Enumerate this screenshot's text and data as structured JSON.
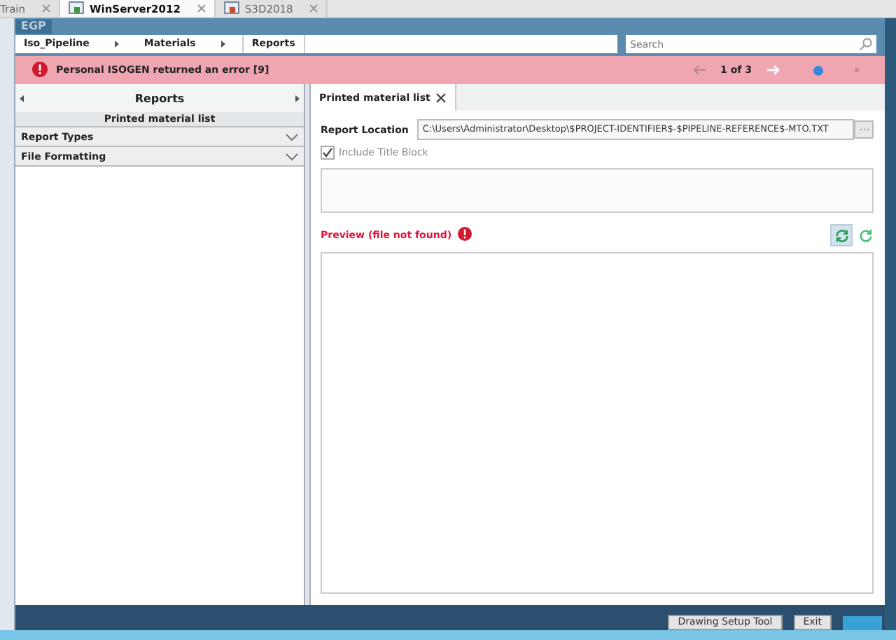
{
  "vm_tabs": [
    {
      "label": "Train",
      "selected": false
    },
    {
      "label": "WinServer2012",
      "selected": true
    },
    {
      "label": "S3D2018",
      "selected": false
    }
  ],
  "app": {
    "logo": "EGP"
  },
  "breadcrumb": [
    "Iso_Pipeline",
    "Materials",
    "Reports"
  ],
  "search": {
    "placeholder": "Search"
  },
  "banner": {
    "message": "Personal ISOGEN returned an error [9]",
    "counter": "1 of 3"
  },
  "left_panel": {
    "title": "Reports",
    "subtitle": "Printed material list",
    "sections": [
      {
        "label": "Report Types",
        "expanded": false
      },
      {
        "label": "File Formatting",
        "expanded": false
      }
    ]
  },
  "doc_tabs": [
    {
      "label": "Printed material list",
      "selected": true
    }
  ],
  "report_location": {
    "label": "Report Location",
    "value": "C:\\Users\\Administrator\\Desktop\\$PROJECT-IDENTIFIER$-$PIPELINE-REFERENCE$-MTO.TXT"
  },
  "include_title_block": {
    "label": "Include Title Block",
    "checked": true,
    "disabled": true
  },
  "preview": {
    "label": "Preview (file not found)"
  },
  "footer_buttons": [
    "Drawing Setup Tool",
    "Exit"
  ]
}
